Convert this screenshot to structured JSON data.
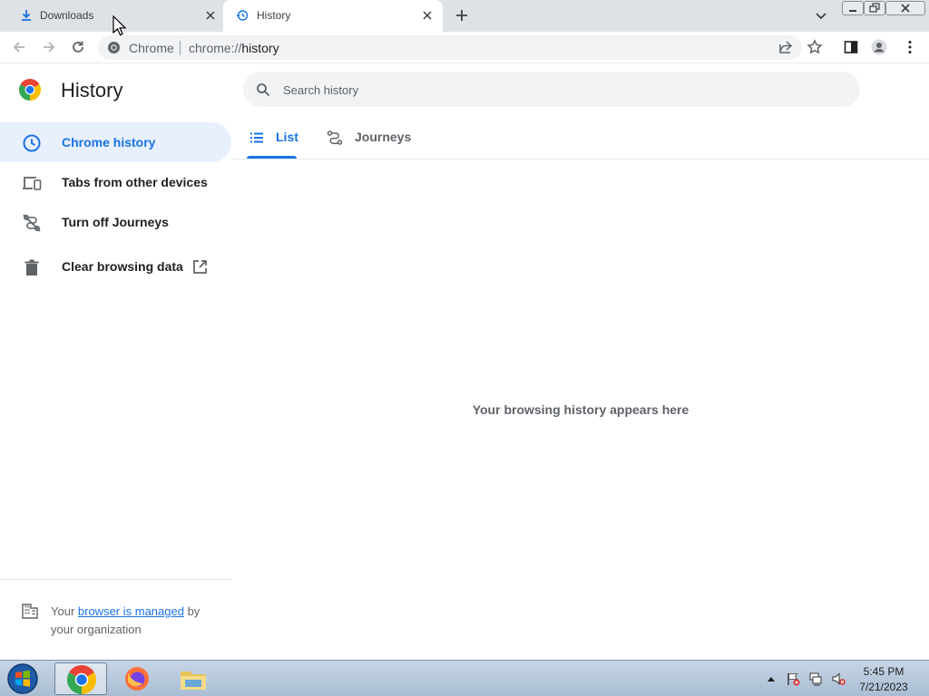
{
  "browser": {
    "tabs": [
      {
        "title": "Downloads",
        "icon": "download-icon",
        "active": false
      },
      {
        "title": "History",
        "icon": "history-clock-icon",
        "active": true
      }
    ],
    "omnibox": {
      "site_label": "Chrome",
      "url_scheme": "chrome://",
      "url_path": "history"
    }
  },
  "page": {
    "title": "History",
    "search": {
      "placeholder": "Search history",
      "value": ""
    },
    "sidebar": {
      "items": [
        {
          "label": "Chrome history",
          "icon": "clock-icon",
          "selected": true
        },
        {
          "label": "Tabs from other devices",
          "icon": "devices-icon",
          "selected": false
        },
        {
          "label": "Turn off Journeys",
          "icon": "journeys-off-icon",
          "selected": false
        },
        {
          "label": "Clear browsing data",
          "icon": "trash-icon",
          "selected": false
        }
      ],
      "managed": {
        "prefix": "Your ",
        "link": "browser is managed",
        "suffix": " by your organization"
      }
    },
    "tabs": [
      {
        "label": "List",
        "icon": "list-icon",
        "selected": true
      },
      {
        "label": "Journeys",
        "icon": "journeys-icon",
        "selected": false
      }
    ],
    "empty_message": "Your browsing history appears here"
  },
  "taskbar": {
    "apps": [
      "Chrome",
      "Firefox",
      "File Explorer"
    ],
    "clock": {
      "time": "5:45 PM",
      "date": "7/21/2023"
    }
  },
  "colors": {
    "accent": "#1a73e8",
    "tab_strip": "#dee1e6",
    "selected_bg": "#e8f0fe",
    "muted_text": "#5f6368"
  }
}
